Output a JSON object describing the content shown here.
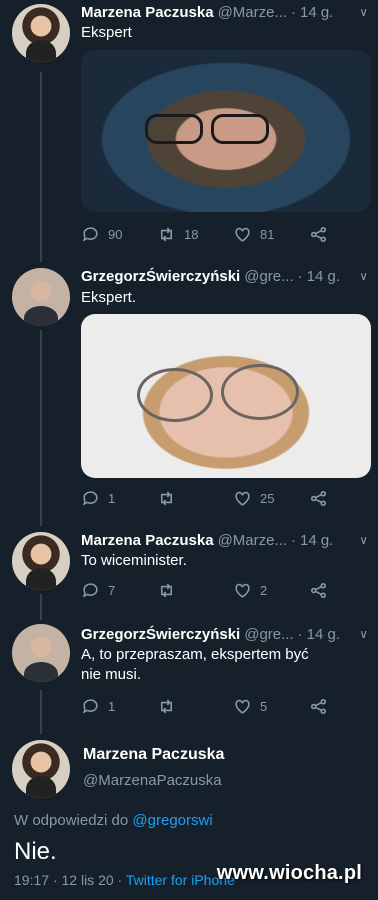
{
  "tweets": [
    {
      "name": "Marzena Paczuska",
      "handle": "@Marze...",
      "time": "14 g.",
      "text": "Ekspert",
      "replies": "90",
      "retweets": "18",
      "likes": "81"
    },
    {
      "name": "GrzegorzŚwierczyński",
      "handle": "@gre...",
      "time": "14 g.",
      "text": "Ekspert.",
      "replies": "1",
      "retweets": "",
      "likes": "25"
    },
    {
      "name": "Marzena Paczuska",
      "handle": "@Marze...",
      "time": "14 g.",
      "text": "To wiceminister.",
      "replies": "7",
      "retweets": "",
      "likes": "2"
    },
    {
      "name": "GrzegorzŚwierczyński",
      "handle": "@gre...",
      "time": "14 g.",
      "text": "A, to przepraszam, ekspertem być nie musi.",
      "replies": "1",
      "retweets": "",
      "likes": "5"
    }
  ],
  "main": {
    "name": "Marzena Paczuska",
    "handle": "@MarzenaPaczuska",
    "reply_prefix": "W odpowiedzi do",
    "reply_to": "@gregorswi",
    "text": "Nie.",
    "time": "19:17",
    "date": "12 lis 20",
    "source": "Twitter for iPhone"
  },
  "watermark": "www.wiocha.pl",
  "icons": {
    "reply": "reply-icon",
    "retweet": "retweet-icon",
    "like": "heart-icon",
    "share": "share-icon",
    "more": "chevron-down-icon"
  },
  "colors": {
    "background": "#15202b",
    "secondary_text": "#8899a6",
    "link": "#1da1f2",
    "thread_line": "#38444d"
  }
}
